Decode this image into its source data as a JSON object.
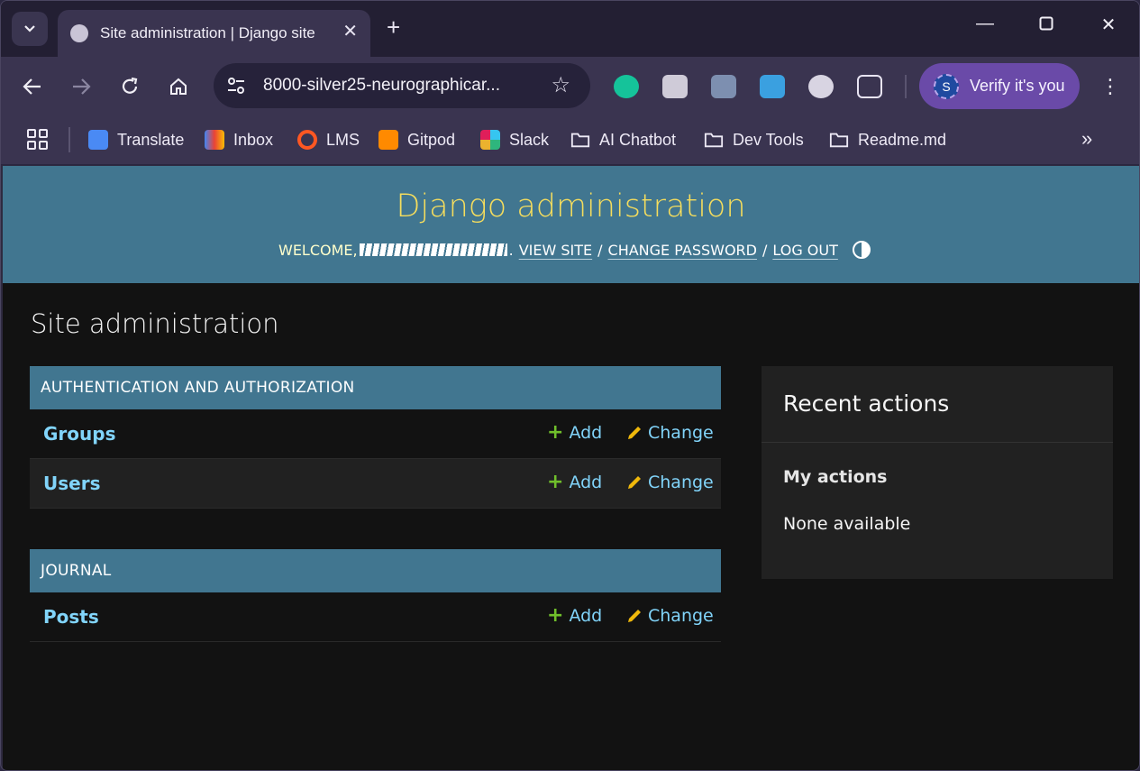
{
  "browser": {
    "tab_title": "Site administration | Django site",
    "new_tab_label": "+",
    "url": "8000-silver25-neurographicar...",
    "verify_label": "Verify it's you",
    "verify_avatar": "S",
    "bookmarks": [
      {
        "label": "Translate",
        "icon": "google-translate-icon",
        "color": "#4a8af4"
      },
      {
        "label": "Inbox",
        "icon": "gmail-icon",
        "color": "#ea4335"
      },
      {
        "label": "LMS",
        "icon": "lms-icon",
        "color": "#ff5722"
      },
      {
        "label": "Gitpod",
        "icon": "gitpod-icon",
        "color": "#ff8a00"
      },
      {
        "label": "Slack",
        "icon": "slack-icon",
        "color": "#36c5f0"
      },
      {
        "label": "AI Chatbot",
        "icon": "folder-icon",
        "color": "#eeeaf6"
      },
      {
        "label": "Dev Tools",
        "icon": "folder-icon",
        "color": "#eeeaf6"
      },
      {
        "label": "Readme.md",
        "icon": "folder-icon",
        "color": "#eeeaf6"
      }
    ]
  },
  "header": {
    "brand": "Django administration",
    "welcome": "WELCOME,",
    "view_site": "VIEW SITE",
    "change_password": "CHANGE PASSWORD",
    "log_out": "LOG OUT",
    "sep": "/"
  },
  "content": {
    "title": "Site administration",
    "modules": [
      {
        "caption": "AUTHENTICATION AND AUTHORIZATION",
        "models": [
          {
            "name": "Groups",
            "add": "Add",
            "change": "Change"
          },
          {
            "name": "Users",
            "add": "Add",
            "change": "Change"
          }
        ]
      },
      {
        "caption": "JOURNAL",
        "models": [
          {
            "name": "Posts",
            "add": "Add",
            "change": "Change"
          }
        ]
      }
    ]
  },
  "recent": {
    "title": "Recent actions",
    "subtitle": "My actions",
    "empty": "None available"
  },
  "colors": {
    "header_bg": "#417690",
    "brand": "#f5dd5d",
    "link": "#81d4fa",
    "add_icon": "#70bf2b",
    "change_icon": "#efb80b"
  }
}
